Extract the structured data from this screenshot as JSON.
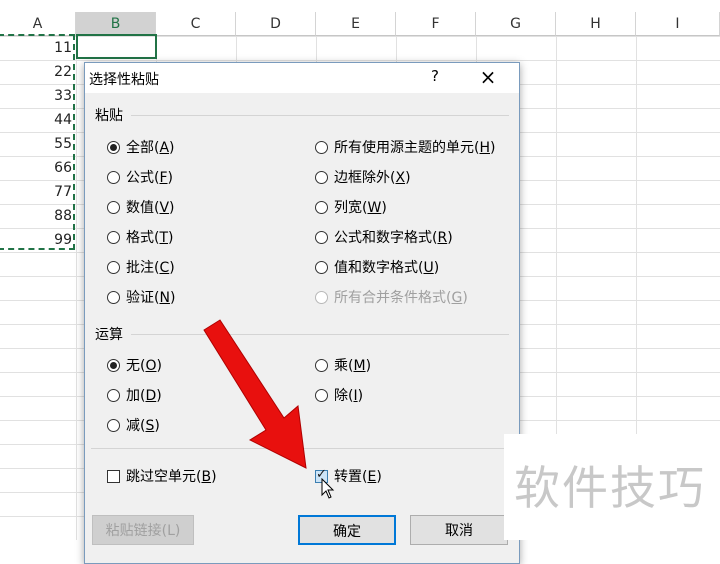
{
  "sheet": {
    "columns": [
      "A",
      "B",
      "C",
      "D",
      "E",
      "F",
      "G",
      "H",
      "I"
    ],
    "selected_column": "B",
    "column_a_values": [
      "11",
      "22",
      "33",
      "44",
      "55",
      "66",
      "77",
      "88",
      "99"
    ]
  },
  "dialog": {
    "title": "选择性粘贴",
    "help_label": "?",
    "close_label": "×",
    "paste": {
      "label": "粘贴",
      "left": [
        {
          "text": "全部(",
          "key": "A",
          "end": ")",
          "checked": true
        },
        {
          "text": "公式(",
          "key": "F",
          "end": ")",
          "checked": false
        },
        {
          "text": "数值(",
          "key": "V",
          "end": ")",
          "checked": false
        },
        {
          "text": "格式(",
          "key": "T",
          "end": ")",
          "checked": false
        },
        {
          "text": "批注(",
          "key": "C",
          "end": ")",
          "checked": false
        },
        {
          "text": "验证(",
          "key": "N",
          "end": ")",
          "checked": false
        }
      ],
      "right": [
        {
          "text": "所有使用源主题的单元(",
          "key": "H",
          "end": ")",
          "checked": false,
          "disabled": false
        },
        {
          "text": "边框除外(",
          "key": "X",
          "end": ")",
          "checked": false,
          "disabled": false
        },
        {
          "text": "列宽(",
          "key": "W",
          "end": ")",
          "checked": false,
          "disabled": false
        },
        {
          "text": "公式和数字格式(",
          "key": "R",
          "end": ")",
          "checked": false,
          "disabled": false
        },
        {
          "text": "值和数字格式(",
          "key": "U",
          "end": ")",
          "checked": false,
          "disabled": false
        },
        {
          "text": "所有合并条件格式(",
          "key": "G",
          "end": ")",
          "checked": false,
          "disabled": true
        }
      ]
    },
    "operation": {
      "label": "运算",
      "left": [
        {
          "text": "无(",
          "key": "O",
          "end": ")",
          "checked": true
        },
        {
          "text": "加(",
          "key": "D",
          "end": ")",
          "checked": false
        },
        {
          "text": "减(",
          "key": "S",
          "end": ")",
          "checked": false
        }
      ],
      "right": [
        {
          "text": "乘(",
          "key": "M",
          "end": ")",
          "checked": false
        },
        {
          "text": "除(",
          "key": "I",
          "end": ")",
          "checked": false
        }
      ]
    },
    "skip_blanks": {
      "text": "跳过空单元(",
      "key": "B",
      "end": ")",
      "checked": false
    },
    "transpose": {
      "text": "转置(",
      "key": "E",
      "end": ")",
      "checked": true
    },
    "buttons": {
      "paste_link": "粘贴链接(L)",
      "ok": "确定",
      "cancel": "取消"
    }
  },
  "watermark": "软件技巧",
  "colors": {
    "accent": "#217346",
    "arrow": "#e8100e",
    "focus": "#0078d7"
  }
}
